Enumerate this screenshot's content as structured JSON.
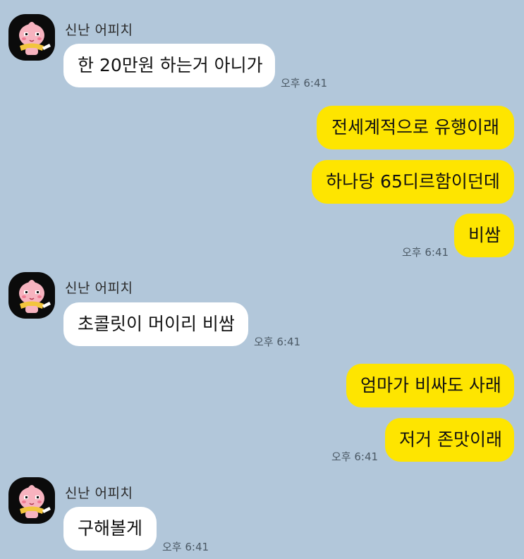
{
  "colors": {
    "background": "#b2c7da",
    "incoming_bubble": "#ffffff",
    "outgoing_bubble": "#fee500",
    "timestamp": "#4a5864"
  },
  "sender_avatar_icon": "apeach-character-icon",
  "groups": [
    {
      "sender": "신난 어피치",
      "messages": [
        "한 20만원 하는거 아니가"
      ],
      "time": "오후 6:41"
    },
    {
      "direction": "outgoing",
      "messages": [
        "전세계적으로 유행이래",
        "하나당 65디르함이던데",
        "비쌈"
      ],
      "time": "오후 6:41"
    },
    {
      "sender": "신난 어피치",
      "messages": [
        "초콜릿이 머이리 비쌈"
      ],
      "time": "오후 6:41"
    },
    {
      "direction": "outgoing",
      "messages": [
        "엄마가 비싸도 사래",
        "저거 존맛이래"
      ],
      "time": "오후 6:41"
    },
    {
      "sender": "신난 어피치",
      "messages": [
        "구해볼게"
      ],
      "time": "오후 6:41"
    }
  ]
}
